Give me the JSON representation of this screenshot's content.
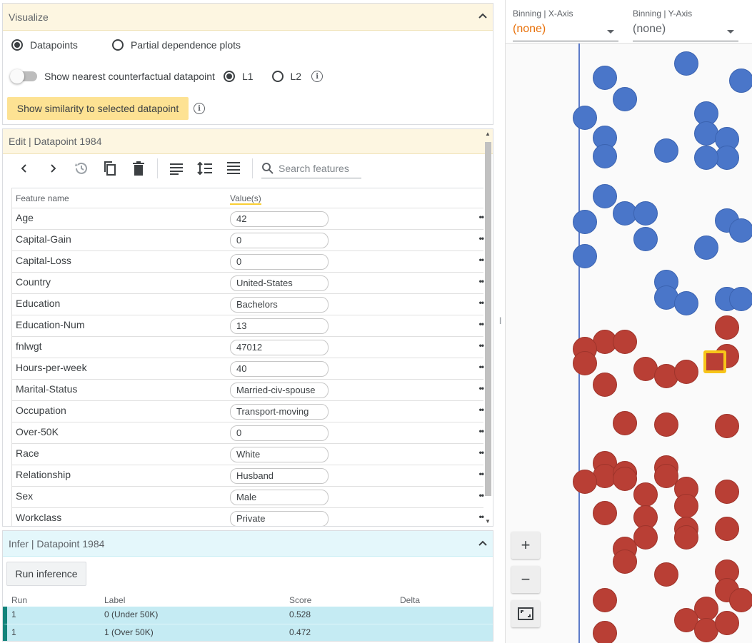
{
  "visualize": {
    "title": "Visualize",
    "options": [
      {
        "label": "Datapoints",
        "selected": true
      },
      {
        "label": "Partial dependence plots",
        "selected": false
      }
    ],
    "counterfactual_label": "Show nearest counterfactual datapoint",
    "distance_options": [
      {
        "label": "L1",
        "selected": true
      },
      {
        "label": "L2",
        "selected": false
      }
    ],
    "similarity_button": "Show similarity to selected datapoint"
  },
  "edit": {
    "title": "Edit | Datapoint 1984",
    "search_placeholder": "Search features",
    "col_feature": "Feature name",
    "col_value": "Value(s)",
    "features": [
      {
        "name": "Age",
        "value": "42"
      },
      {
        "name": "Capital-Gain",
        "value": "0"
      },
      {
        "name": "Capital-Loss",
        "value": "0"
      },
      {
        "name": "Country",
        "value": "United-States"
      },
      {
        "name": "Education",
        "value": "Bachelors"
      },
      {
        "name": "Education-Num",
        "value": "13"
      },
      {
        "name": "fnlwgt",
        "value": "47012"
      },
      {
        "name": "Hours-per-week",
        "value": "40"
      },
      {
        "name": "Marital-Status",
        "value": "Married-civ-spouse"
      },
      {
        "name": "Occupation",
        "value": "Transport-moving"
      },
      {
        "name": "Over-50K",
        "value": "0"
      },
      {
        "name": "Race",
        "value": "White"
      },
      {
        "name": "Relationship",
        "value": "Husband"
      },
      {
        "name": "Sex",
        "value": "Male"
      },
      {
        "name": "Workclass",
        "value": "Private"
      }
    ]
  },
  "infer": {
    "title": "Infer | Datapoint 1984",
    "run_button": "Run inference",
    "columns": [
      "Run",
      "Label",
      "Score",
      "Delta"
    ],
    "rows": [
      {
        "run": "1",
        "label": "0 (Under 50K)",
        "score": "0.528",
        "delta": ""
      },
      {
        "run": "1",
        "label": "1 (Over 50K)",
        "score": "0.472",
        "delta": ""
      }
    ]
  },
  "binning": {
    "x_label": "Binning | X-Axis",
    "x_value": "(none)",
    "y_label": "Binning | Y-Axis",
    "y_value": "(none)"
  },
  "zoom": {
    "in": "+",
    "out": "−"
  },
  "colors": {
    "class_0": "#4a76c9",
    "class_1": "#b93f35",
    "selected": "#f7c519",
    "accent_orange": "#e8710a",
    "visualize_header": "#fdf6e1",
    "infer_header": "#e4f7fb"
  }
}
